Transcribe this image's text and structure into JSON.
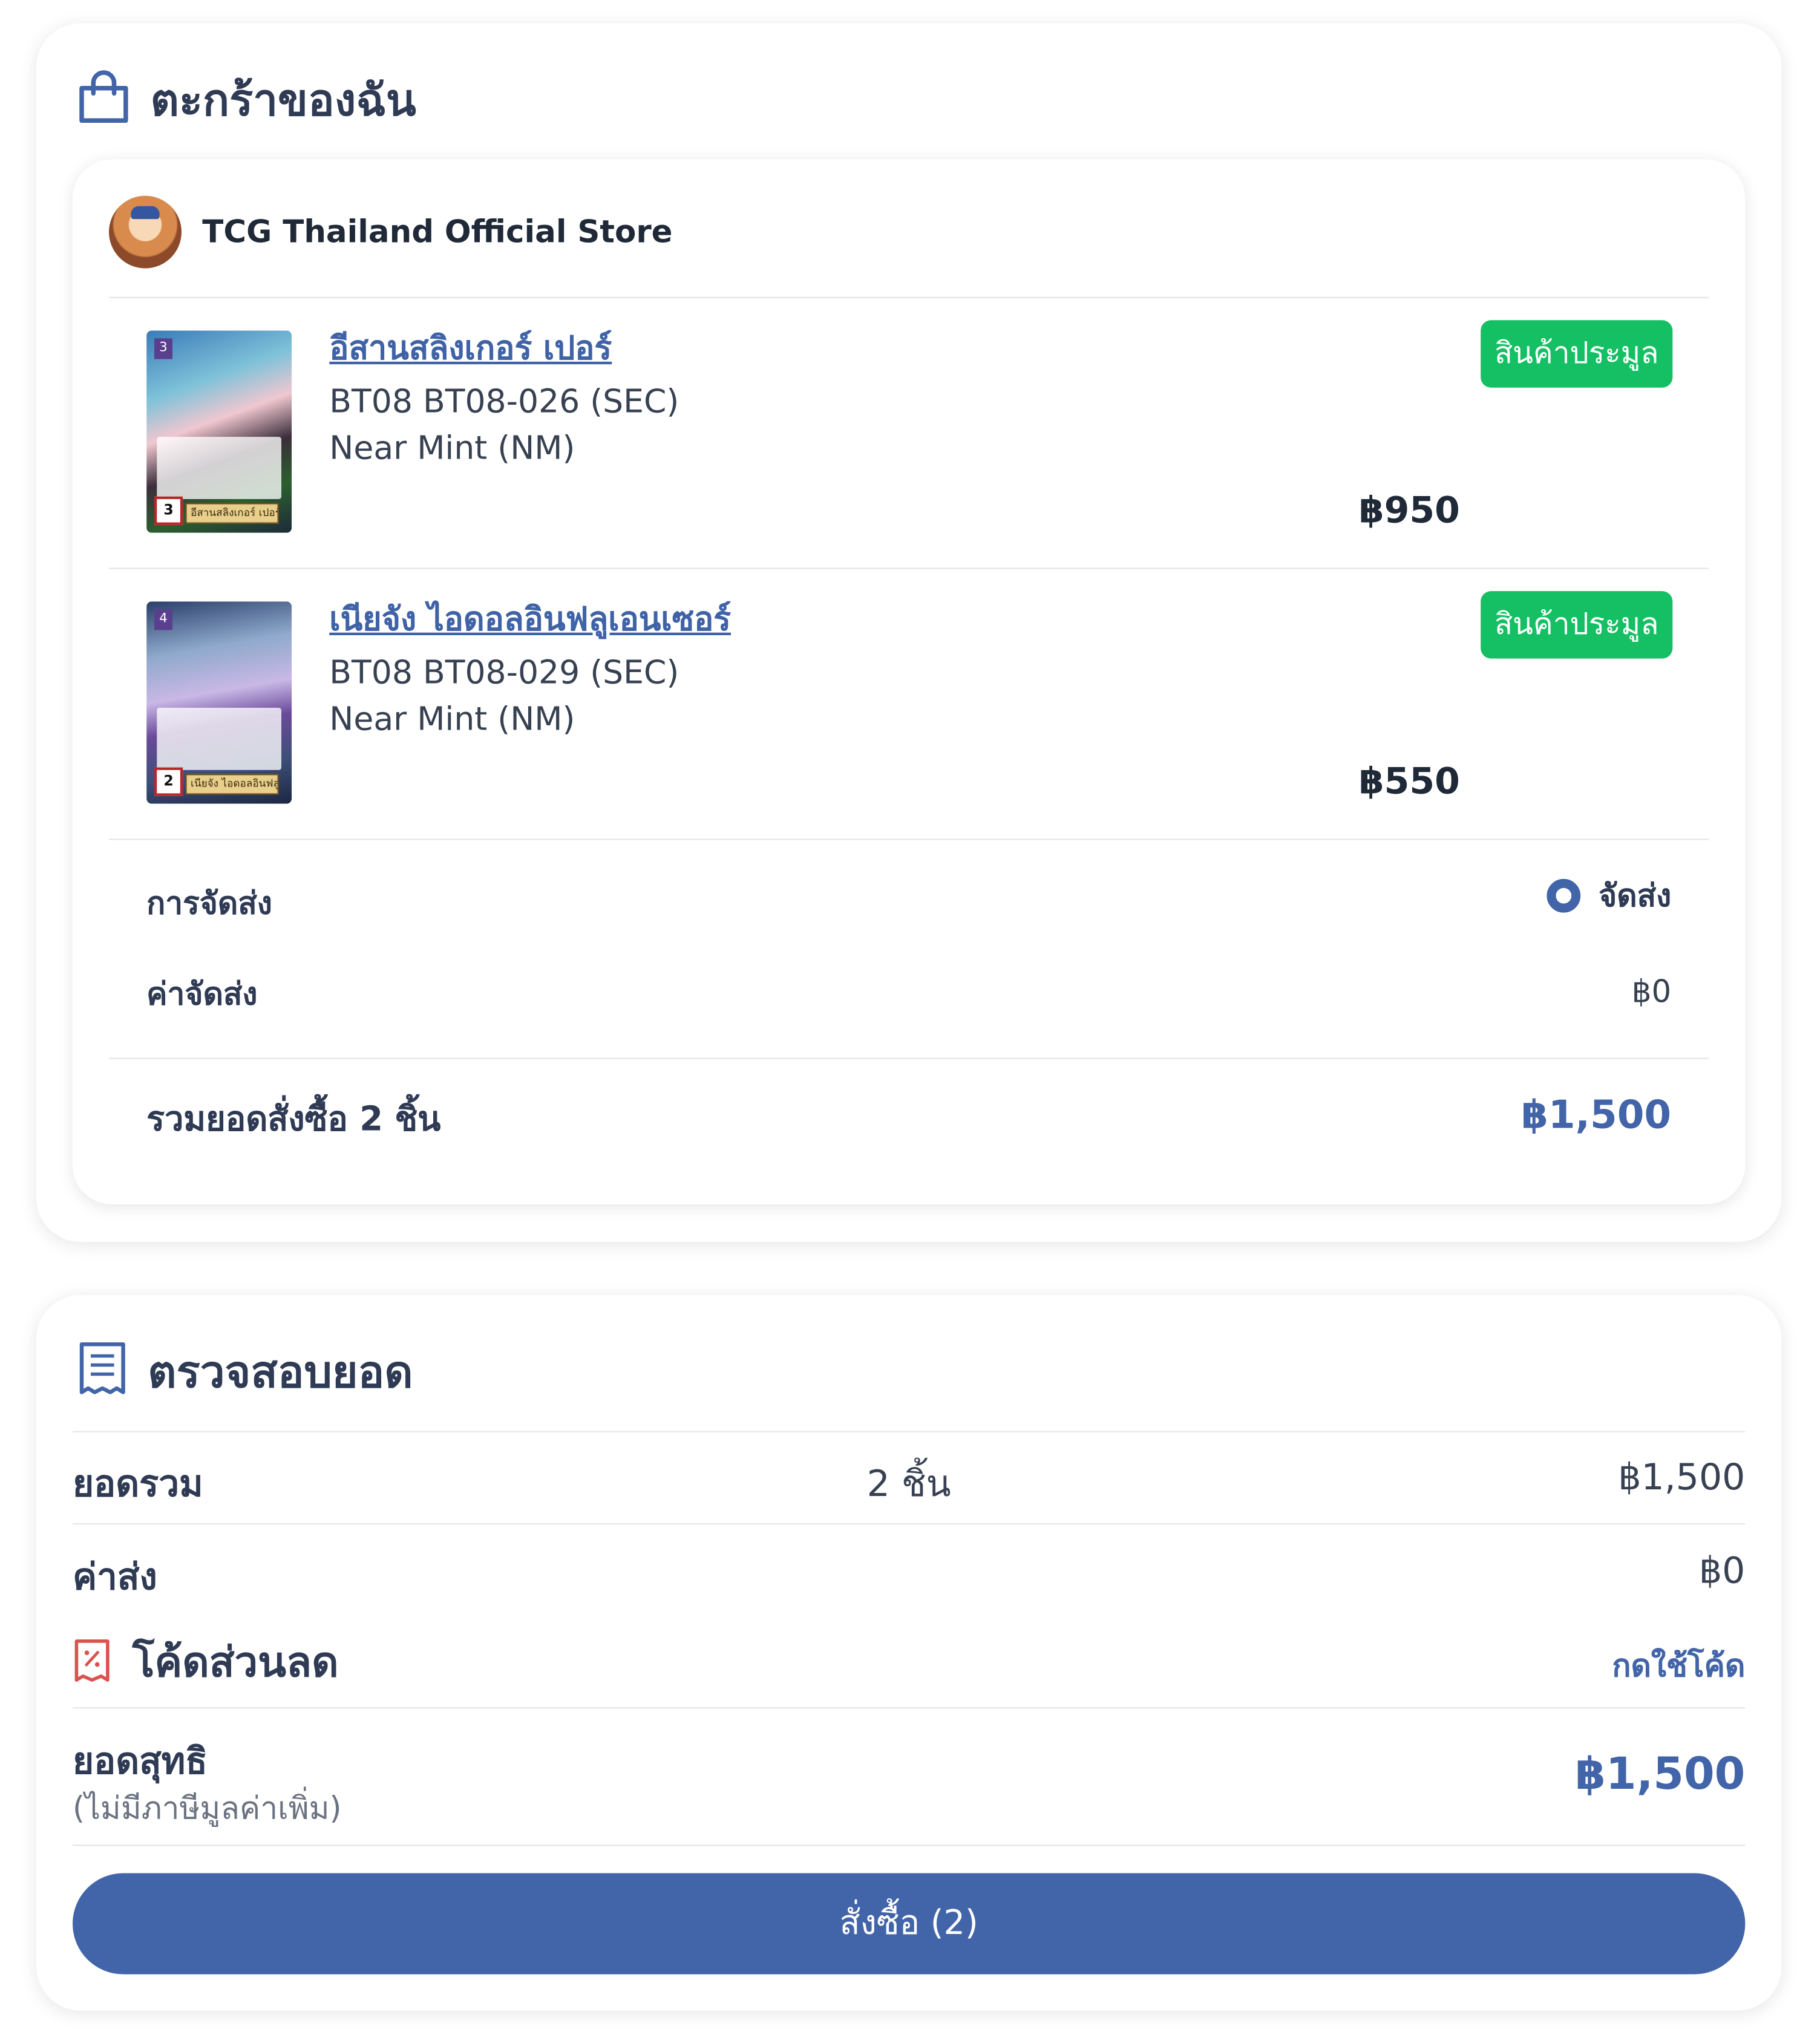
{
  "cart": {
    "title": "ตะกร้าของฉัน",
    "store_name": "TCG Thailand Official Store",
    "items": [
      {
        "name": "อีสานสลิงเกอร์ เปอร์",
        "code": "BT08 BT08-026 (SEC)",
        "condition": "Near Mint (NM)",
        "badge": "สินค้าประมูล",
        "price": "฿950",
        "card_cost": "3",
        "card_power": "3",
        "card_name": "อีสานสลิงเกอร์ เปอร์"
      },
      {
        "name": "เนียจัง ไอดอลอินฟลูเอนเซอร์",
        "code": "BT08 BT08-029 (SEC)",
        "condition": "Near Mint (NM)",
        "badge": "สินค้าประมูล",
        "price": "฿550",
        "card_cost": "4",
        "card_power": "2",
        "card_name": "เนียจัง ไอดอลอินฟลูเอนเซอร์"
      }
    ],
    "shipping_label": "การจัดส่ง",
    "shipping_option": "จัดส่ง",
    "shipping_fee_label": "ค่าจัดส่ง",
    "shipping_fee": "฿0",
    "total_label": "รวมยอดสั่งซื้อ 2 ชิ้น",
    "total_value": "฿1,500"
  },
  "summary": {
    "title": "ตรวจสอบยอด",
    "subtotal_label": "ยอดรวม",
    "subtotal_qty": "2 ชิ้น",
    "subtotal_value": "฿1,500",
    "shipping_label": "ค่าส่ง",
    "shipping_value": "฿0",
    "coupon_label": "โค้ดส่วนลด",
    "coupon_link": "กดใช้โค้ด",
    "net_label": "ยอดสุทธิ",
    "net_note": "(ไม่มีภาษีมูลค่าเพิ่ม)",
    "net_value": "฿1,500",
    "order_button": "สั่งซื้อ (2)"
  },
  "colors": {
    "accent": "#4264a8",
    "badge_green": "#14c063",
    "coupon_icon": "#d9534f"
  },
  "icons": {
    "cart": "shopping-bag-icon",
    "summary": "receipt-icon",
    "coupon": "discount-coupon-icon"
  }
}
